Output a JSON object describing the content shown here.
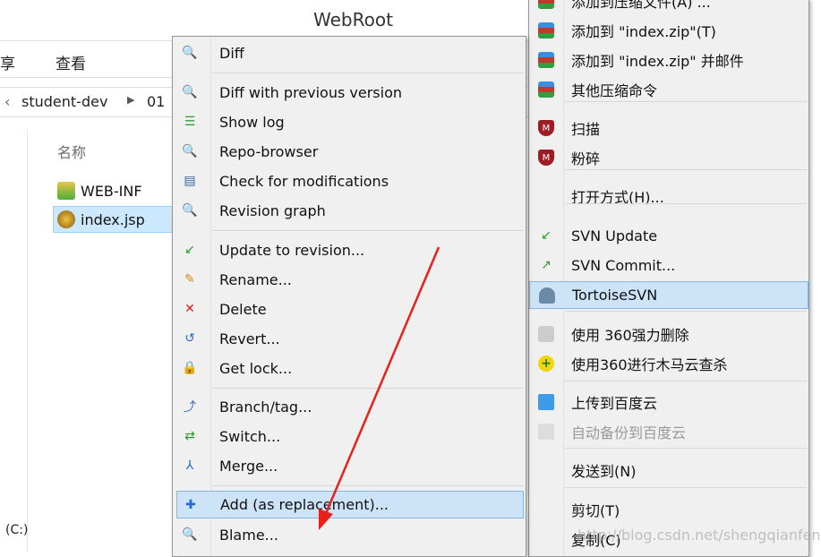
{
  "explorer": {
    "title": "WebRoot",
    "ribbon": [
      "享",
      "查看"
    ],
    "breadcrumb": [
      "student-dev",
      "01"
    ],
    "column_header": "名称",
    "files": [
      {
        "name": "WEB-INF",
        "icon": "svn-folder-ok-icon"
      },
      {
        "name": "index.jsp",
        "icon": "svn-file-conflict-icon",
        "selected": true
      }
    ],
    "drive": "(C:)"
  },
  "svn_menu": {
    "items": [
      {
        "label": "Diff",
        "icon": "diff-icon"
      },
      {
        "label": "Diff with previous version",
        "icon": "diff-icon"
      },
      {
        "label": "Show log",
        "icon": "log-icon"
      },
      {
        "label": "Repo-browser",
        "icon": "repo-browser-icon"
      },
      {
        "label": "Check for modifications",
        "icon": "check-modifications-icon"
      },
      {
        "label": "Revision graph",
        "icon": "revision-graph-icon"
      },
      {
        "label": "Update to revision...",
        "icon": "update-icon"
      },
      {
        "label": "Rename...",
        "icon": "rename-icon"
      },
      {
        "label": "Delete",
        "icon": "delete-icon"
      },
      {
        "label": "Revert...",
        "icon": "revert-icon"
      },
      {
        "label": "Get lock...",
        "icon": "lock-icon"
      },
      {
        "label": "Branch/tag...",
        "icon": "branch-icon"
      },
      {
        "label": "Switch...",
        "icon": "switch-icon"
      },
      {
        "label": "Merge...",
        "icon": "merge-icon"
      },
      {
        "label": "Add (as replacement)...",
        "icon": "add-icon",
        "highlighted": true
      },
      {
        "label": "Blame...",
        "icon": "blame-icon"
      }
    ]
  },
  "context_menu": {
    "items": [
      {
        "label": "添加到压缩文件(A) ...",
        "icon": "winrar-icon"
      },
      {
        "label": "添加到 \"index.zip\"(T)",
        "icon": "winrar-icon"
      },
      {
        "label": "添加到 \"index.zip\" 并邮件",
        "icon": "winrar-icon"
      },
      {
        "label": "其他压缩命令",
        "icon": "winrar-icon"
      },
      {
        "label": "扫描",
        "icon": "mcafee-icon"
      },
      {
        "label": "粉碎",
        "icon": "mcafee-icon"
      },
      {
        "label": "打开方式(H)...",
        "icon": ""
      },
      {
        "label": "SVN Update",
        "icon": "svn-update-icon"
      },
      {
        "label": "SVN Commit...",
        "icon": "svn-commit-icon"
      },
      {
        "label": "TortoiseSVN",
        "icon": "tortoise-icon",
        "highlighted": true
      },
      {
        "label": "使用 360强力删除",
        "icon": "shredder-icon"
      },
      {
        "label": "使用360进行木马云查杀",
        "icon": "360-icon"
      },
      {
        "label": "上传到百度云",
        "icon": "baidu-cloud-icon"
      },
      {
        "label": "自动备份到百度云",
        "icon": "baidu-cloud-icon",
        "disabled": true
      },
      {
        "label": "发送到(N)",
        "icon": ""
      },
      {
        "label": "剪切(T)",
        "icon": ""
      },
      {
        "label": "复制(C)",
        "icon": ""
      }
    ]
  },
  "watermark": "http://blog.csdn.net/shengqianfeng",
  "colors": {
    "highlight": "#cde3f7",
    "arrow": "#e8211b",
    "menu_bg": "#f0f0f0"
  }
}
